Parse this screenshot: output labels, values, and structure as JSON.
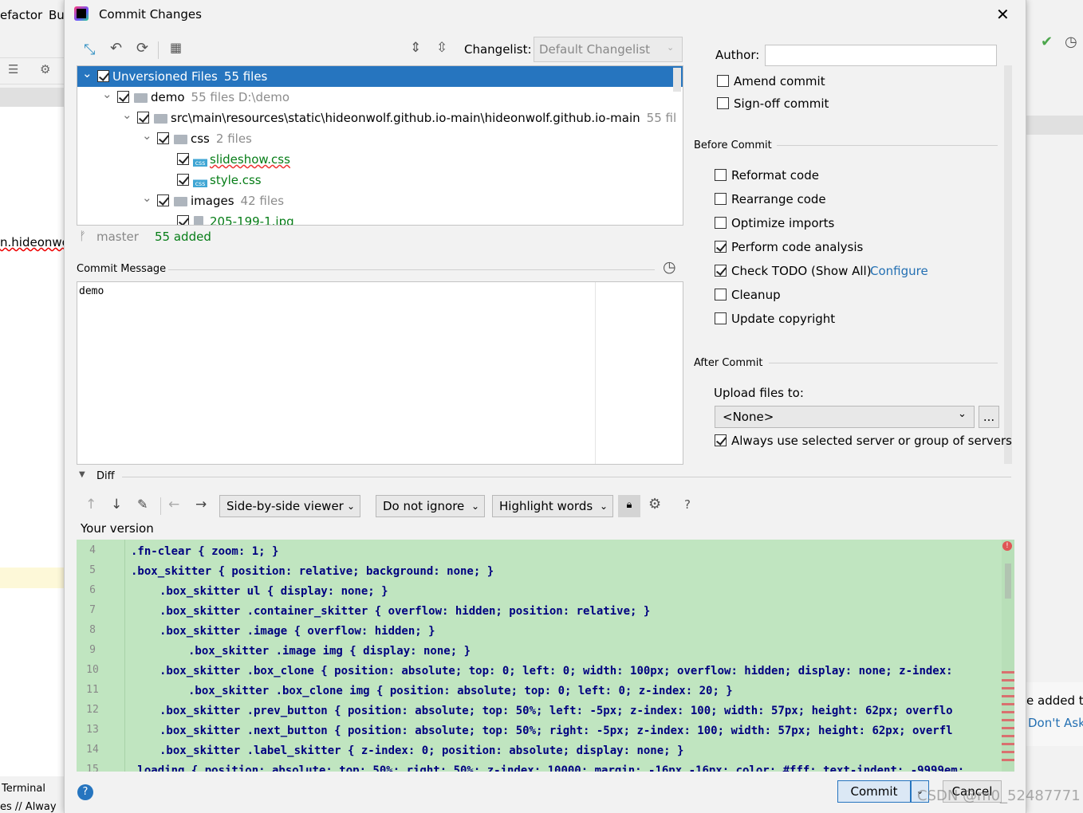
{
  "background_ide": {
    "menu_items": [
      "efactor",
      "Bu"
    ],
    "editor_text": "n.hideonwo",
    "terminal_tab": "Terminal",
    "status_text": "es // Alway",
    "notification_text": "e added t",
    "notification_link": "Don't Ask",
    "watermark": "CSDN @m0_52487771"
  },
  "dialog": {
    "title": "Commit Changes",
    "close_icon": "close-icon"
  },
  "toolbar": {
    "icons": [
      "refresh-arrows-icon",
      "rollback-icon",
      "refresh-icon",
      "group-by-icon",
      "expand-all-icon",
      "collapse-all-icon"
    ],
    "changelist_label": "Changelist:",
    "changelist_value": "Default Changelist"
  },
  "tree": [
    {
      "level": 0,
      "name": "Unversioned Files",
      "meta": "55 files",
      "checked": true,
      "expanded": true,
      "type": "root",
      "selected": true
    },
    {
      "level": 1,
      "name": "demo",
      "meta": "55 files  D:\\demo",
      "checked": true,
      "expanded": true,
      "type": "module"
    },
    {
      "level": 2,
      "name": "src\\main\\resources\\static\\hideonwolf.github.io-main\\hideonwolf.github.io-main",
      "meta": "55 fil",
      "checked": true,
      "expanded": true,
      "type": "folder"
    },
    {
      "level": 3,
      "name": "css",
      "meta": "2 files",
      "checked": true,
      "expanded": true,
      "type": "folder"
    },
    {
      "level": 4,
      "name": "slideshow.css",
      "meta": "",
      "checked": true,
      "type": "css"
    },
    {
      "level": 4,
      "name": "style.css",
      "meta": "",
      "checked": true,
      "type": "css"
    },
    {
      "level": 3,
      "name": "images",
      "meta": "42 files",
      "checked": true,
      "expanded": true,
      "type": "folder"
    },
    {
      "level": 4,
      "name": "205-199-1.jpg",
      "meta": "",
      "checked": true,
      "type": "image"
    }
  ],
  "status": {
    "branch": "master",
    "added": "55 added"
  },
  "commit_message": {
    "label": "Commit Message",
    "value": "demo"
  },
  "right": {
    "author_label": "Author:",
    "author_value": "",
    "amend": "Amend commit",
    "signoff": "Sign-off commit",
    "before_commit": "Before Commit",
    "before_options": [
      {
        "label": "Reformat code",
        "checked": false
      },
      {
        "label": "Rearrange code",
        "checked": false
      },
      {
        "label": "Optimize imports",
        "checked": false
      },
      {
        "label": "Perform code analysis",
        "checked": true
      },
      {
        "label": "Check TODO (Show All)",
        "checked": true,
        "link": "Configure"
      },
      {
        "label": "Cleanup",
        "checked": false
      },
      {
        "label": "Update copyright",
        "checked": false
      }
    ],
    "after_commit": "After Commit",
    "upload_label": "Upload files to:",
    "upload_value": "<None>",
    "browse": "...",
    "always_use": "Always use selected server or group of servers",
    "always_checked": true
  },
  "diff": {
    "label": "Diff",
    "viewer": "Side-by-side viewer",
    "ignore": "Do not ignore",
    "highlight": "Highlight words",
    "help": "?",
    "your_version": "Your version",
    "lines": [
      {
        "n": "4",
        "text": ".fn-clear { zoom: 1; }",
        "indent": 0
      },
      {
        "n": "5",
        "text": ".box_skitter { position: relative; background: none; }",
        "indent": 0
      },
      {
        "n": "6",
        "text": ".box_skitter ul { display: none; }",
        "indent": 1
      },
      {
        "n": "7",
        "text": ".box_skitter .container_skitter { overflow: hidden; position: relative; }",
        "indent": 1
      },
      {
        "n": "8",
        "text": ".box_skitter .image { overflow: hidden; }",
        "indent": 1
      },
      {
        "n": "9",
        "text": ".box_skitter .image img { display: none; }",
        "indent": 2
      },
      {
        "n": "10",
        "text": ".box_skitter .box_clone { position: absolute; top: 0; left: 0; width: 100px; overflow: hidden; display: none; z-index:",
        "indent": 1
      },
      {
        "n": "11",
        "text": ".box_skitter .box_clone img { position: absolute; top: 0; left: 0; z-index: 20; }",
        "indent": 2
      },
      {
        "n": "12",
        "text": ".box_skitter .prev_button { position: absolute; top: 50%; left: -5px; z-index: 100; width: 57px; height: 62px; overflo",
        "indent": 1
      },
      {
        "n": "13",
        "text": ".box_skitter .next_button { position: absolute; top: 50%; right: -5px; z-index: 100; width: 57px; height: 62px; overfl",
        "indent": 1
      },
      {
        "n": "14",
        "text": ".box_skitter .label_skitter { z-index: 0; position: absolute; display: none; }",
        "indent": 1
      },
      {
        "n": "15",
        "text": ".loading { position: absolute; top: 50%; right: 50%; z-index: 10000; margin: -16px -16px; color: #fff; text-indent: -9999em;",
        "indent": 0
      }
    ]
  },
  "footer": {
    "help": "?",
    "commit": "Commit",
    "cancel": "Cancel"
  },
  "colors": {
    "selection": "#2675bf",
    "added_bg": "#c0e5c0",
    "link": "#2470b3",
    "added_text": "#067d17"
  }
}
